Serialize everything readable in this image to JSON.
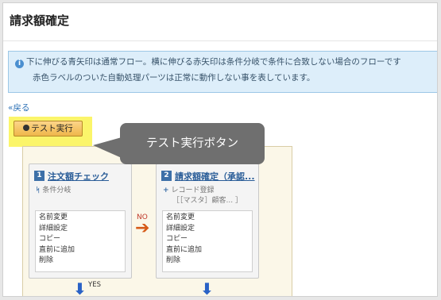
{
  "page": {
    "title": "請求額確定",
    "info_icon": "i",
    "info_line1": "下に伸びる青矢印は通常フロー。横に伸びる赤矢印は条件分岐で条件に合致しない場合のフローです",
    "info_line2": "赤色ラベルのついた自動処理パーツは正常に動作しない事を表しています。",
    "back_link": "«戻る",
    "test_button": "テスト実行",
    "callout": "テスト実行ボタン"
  },
  "flow": {
    "cards": [
      {
        "number": "1",
        "title": "注文額チェック",
        "type_icon": "branch-icon",
        "type_glyph": "ᛋ",
        "subtitle": "条件分岐",
        "detail": "",
        "menu": [
          "名前変更",
          "詳細設定",
          "コピー",
          "直前に追加",
          "削除"
        ]
      },
      {
        "number": "2",
        "title": "請求額確定（承認...",
        "type_icon": "plus-icon",
        "type_glyph": "+",
        "subtitle": "レコード登録",
        "detail": "［［マスタ］顧客... ］",
        "menu": [
          "名前変更",
          "詳細設定",
          "コピー",
          "直前に追加",
          "削除"
        ]
      }
    ],
    "no_label": "NO",
    "yes_label": "YES",
    "right_arrow": "➔",
    "down_arrow": "⬇"
  },
  "colors": {
    "info_background": "#ddeefa",
    "highlight": "#fbf56a",
    "button": "#efb64a",
    "callout": "#6f6f6f",
    "link": "#2a6fb5",
    "flow_down_arrow": "#2a62c6",
    "flow_right_arrow": "#d65a17"
  }
}
